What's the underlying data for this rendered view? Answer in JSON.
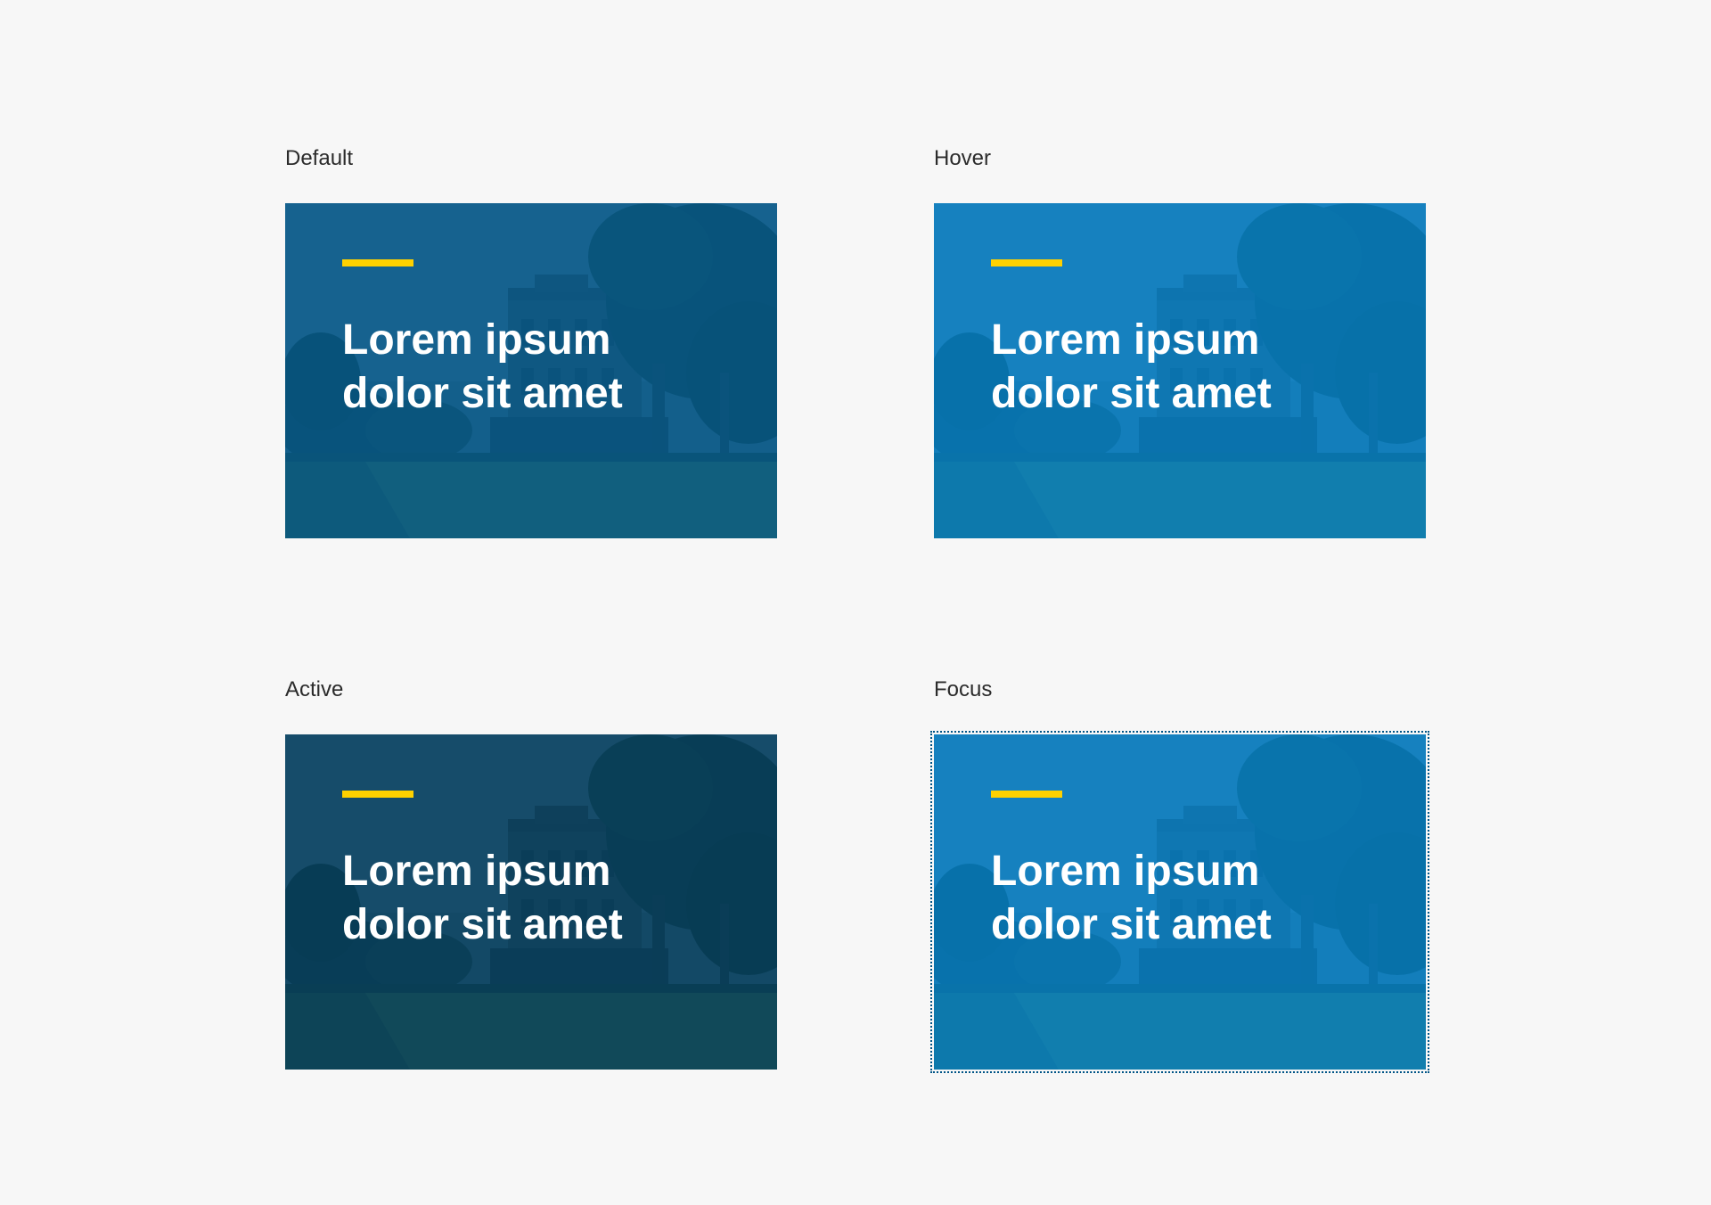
{
  "states": [
    {
      "label": "Default",
      "card_title": "Lorem ipsum\ndolor sit amet",
      "overlay_color": "#005587"
    },
    {
      "label": "Hover",
      "card_title": "Lorem ipsum\ndolor sit amet",
      "overlay_color": "#0079bf"
    },
    {
      "label": "Active",
      "card_title": "Lorem ipsum\ndolor sit amet",
      "overlay_color": "#003b5c"
    },
    {
      "label": "Focus",
      "card_title": "Lorem ipsum\ndolor sit amet",
      "overlay_color": "#0079bf"
    }
  ],
  "colors": {
    "page_background": "#f7f7f7",
    "accent_bar": "#ffd100",
    "title_text": "#ffffff",
    "label_text": "#2b2b2b",
    "focus_ring": "#005587"
  }
}
